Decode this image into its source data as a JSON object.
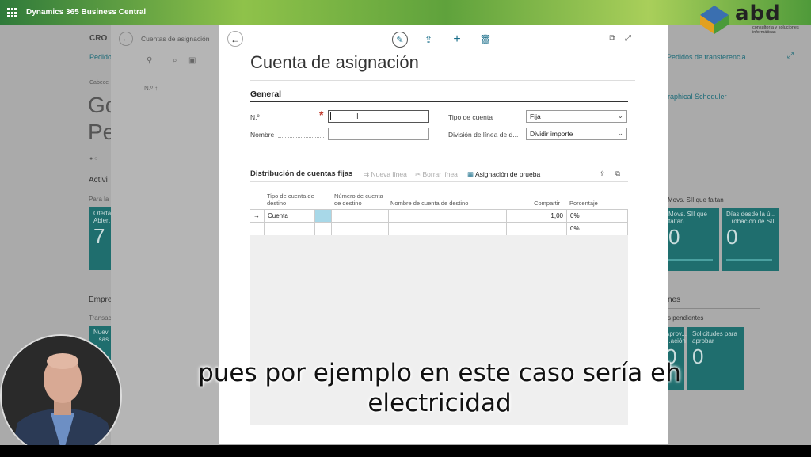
{
  "app": {
    "title": "Dynamics 365 Business Central"
  },
  "logo": {
    "text": "abd",
    "subtitle": "consultoría y soluciones informáticas"
  },
  "background": {
    "company_code": "CRO",
    "nav_pedidos": "Pedido",
    "nav_transfer": "Pedidos de transferencia",
    "cabecera": "Cabece",
    "big_go": "Go",
    "big_pe": "Pe",
    "actividades": "Activi",
    "para_la": "Para la",
    "scheduler": "raphical Scheduler",
    "tile1": {
      "label": "Oferta Abiert",
      "value": "7"
    },
    "empresa": "Empre",
    "transac": "Transac",
    "tile2": {
      "label": "Nuev ...sas",
      "value": ""
    },
    "sii_header": "Movs. SII que faltan",
    "tile3": {
      "label": "Movs. SII que faltan",
      "value": "0"
    },
    "tile4": {
      "label": "Días desde la ú... ...robación de SII",
      "value": "0"
    },
    "nes": "nes",
    "pendientes": "s pendientes",
    "tile5": {
      "label": "Aprov... ...ación",
      "value": "0"
    },
    "tile6": {
      "label": "Solicitudes para aprobar",
      "value": "0"
    }
  },
  "middle_panel": {
    "title": "Cuentas de asignación",
    "col": "N.º ↑"
  },
  "dialog": {
    "title": "Cuenta de asignación",
    "section": "General",
    "fields": {
      "no_label": "N.º",
      "no_value": "",
      "nombre_label": "Nombre",
      "nombre_value": "",
      "tipo_label": "Tipo de cuenta",
      "tipo_value": "Fija",
      "division_label": "División de línea de d...",
      "division_value": "Dividir importe"
    },
    "sublist": {
      "title": "Distribución de cuentas fijas",
      "actions": {
        "new_line": "Nueva línea",
        "delete_line": "Borrar línea",
        "test": "Asignación de prueba",
        "more": "···"
      },
      "columns": [
        "Tipo de cuenta de destino",
        "Número de cuenta de destino",
        "Nombre de cuenta de destino",
        "Compartir",
        "Porcentaje"
      ],
      "rows": [
        {
          "marker": "→",
          "tipo": "Cuenta",
          "numero": "",
          "nombre": "",
          "compartir": "1,00",
          "porcentaje": "0%"
        },
        {
          "marker": "",
          "tipo": "",
          "numero": "",
          "nombre": "",
          "compartir": "",
          "porcentaje": "0%"
        }
      ]
    }
  },
  "caption": {
    "line1": "pues por ejemplo en este caso sería eh",
    "line2": "electricidad"
  },
  "colors": {
    "accent": "#1a6e8a",
    "tile": "#1f6e6e",
    "required": "#c0392b"
  }
}
